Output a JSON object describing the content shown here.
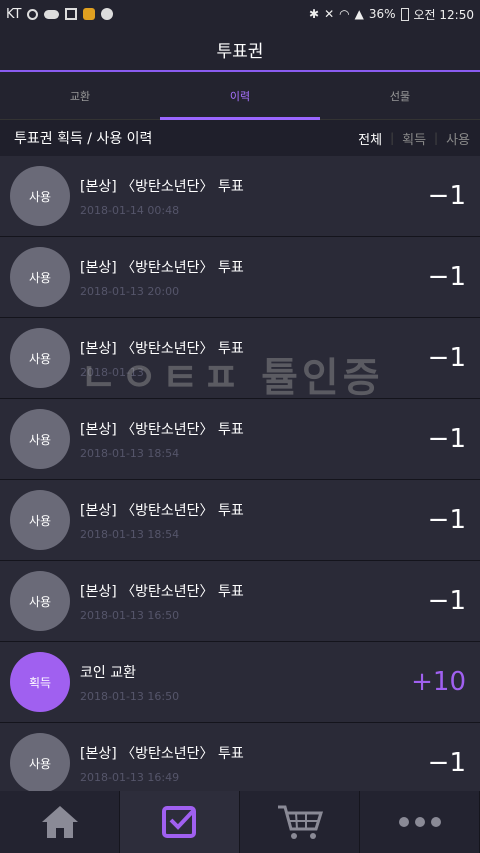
{
  "status_bar": {
    "carrier": "KT",
    "battery": "36%",
    "time": "오전 12:50"
  },
  "header": {
    "title": "투표권"
  },
  "tabs": [
    {
      "label": "교환"
    },
    {
      "label": "이력"
    },
    {
      "label": "선물"
    }
  ],
  "subheader": {
    "title": "투표권 획득 / 사용 이력",
    "filters": [
      "전체",
      "획득",
      "사용"
    ]
  },
  "watermark": "ㄴㅇㅌㅍ 튤인증",
  "rows": [
    {
      "badge": "사용",
      "title": "[본상] 〈방탄소년단〉 투표",
      "date": "2018-01-14 00:48",
      "amount": "−1"
    },
    {
      "badge": "사용",
      "title": "[본상] 〈방탄소년단〉 투표",
      "date": "2018-01-13 20:00",
      "amount": "−1"
    },
    {
      "badge": "사용",
      "title": "[본상] 〈방탄소년단〉 투표",
      "date": "2018-01-13",
      "amount": "−1"
    },
    {
      "badge": "사용",
      "title": "[본상] 〈방탄소년단〉 투표",
      "date": "2018-01-13 18:54",
      "amount": "−1"
    },
    {
      "badge": "사용",
      "title": "[본상] 〈방탄소년단〉 투표",
      "date": "2018-01-13 18:54",
      "amount": "−1"
    },
    {
      "badge": "사용",
      "title": "[본상] 〈방탄소년단〉 투표",
      "date": "2018-01-13 16:50",
      "amount": "−1"
    },
    {
      "badge": "획득",
      "title": "코인 교환",
      "date": "2018-01-13 16:50",
      "amount": "+10"
    },
    {
      "badge": "사용",
      "title": "[본상] 〈방탄소년단〉 투표",
      "date": "2018-01-13 16:49",
      "amount": "−1"
    }
  ],
  "colors": {
    "accent": "#a060f0",
    "background": "#1f1f2b",
    "row": "#2a2a37"
  },
  "nav": [
    {
      "icon": "home-icon"
    },
    {
      "icon": "vote-check-icon"
    },
    {
      "icon": "cart-icon"
    },
    {
      "icon": "more-icon"
    }
  ]
}
